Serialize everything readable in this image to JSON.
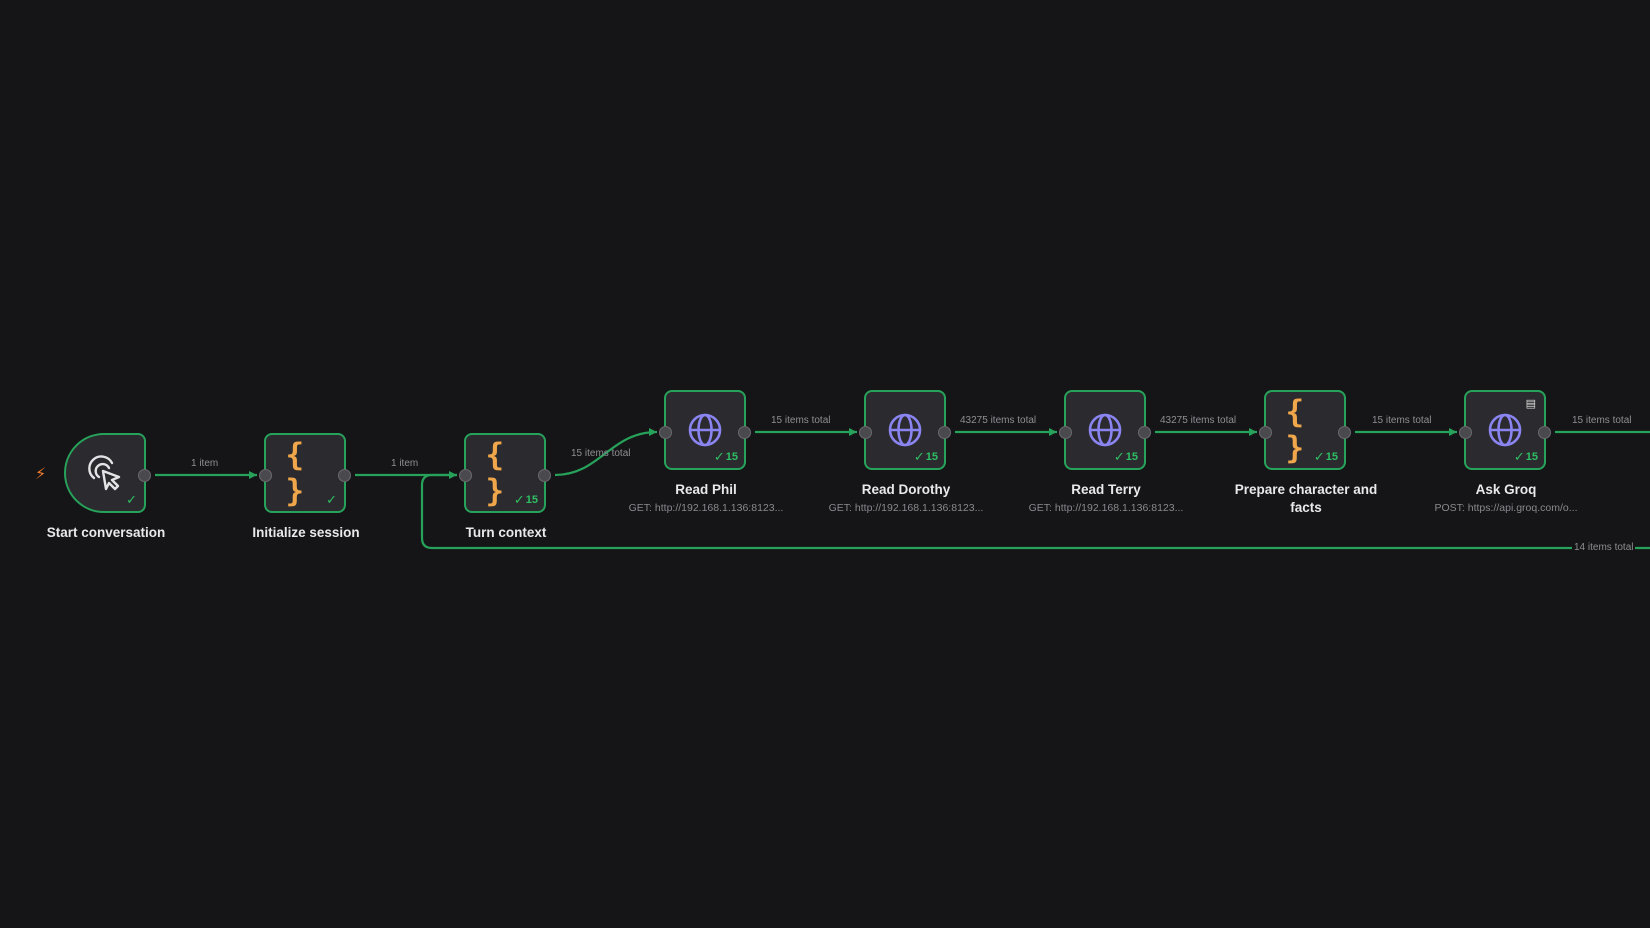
{
  "nodes": [
    {
      "id": "start",
      "label": "Start conversation",
      "icon": "cursor-click-icon",
      "badge": ""
    },
    {
      "id": "init",
      "label": "Initialize session",
      "icon": "code-braces-icon",
      "badge": ""
    },
    {
      "id": "turn",
      "label": "Turn context",
      "icon": "code-braces-icon",
      "badge": "15"
    },
    {
      "id": "phil",
      "label": "Read Phil",
      "subtitle": "GET: http://192.168.1.136:8123...",
      "icon": "globe-icon",
      "badge": "15"
    },
    {
      "id": "dorothy",
      "label": "Read Dorothy",
      "subtitle": "GET: http://192.168.1.136:8123...",
      "icon": "globe-icon",
      "badge": "15"
    },
    {
      "id": "terry",
      "label": "Read Terry",
      "subtitle": "GET: http://192.168.1.136:8123...",
      "icon": "globe-icon",
      "badge": "15"
    },
    {
      "id": "prepare",
      "label": "Prepare character and facts",
      "icon": "code-braces-icon",
      "badge": "15"
    },
    {
      "id": "groq",
      "label": "Ask Groq",
      "subtitle": "POST: https://api.groq.com/o...",
      "icon": "globe-icon",
      "badge": "15"
    }
  ],
  "edges": {
    "start_init": "1 item",
    "init_turn": "1 item",
    "turn_phil": "15 items total",
    "phil_dorothy": "15 items total",
    "dorothy_terry": "43275 items total",
    "terry_prepare": "43275 items total",
    "prepare_groq": "15 items total",
    "groq_out": "15 items total",
    "loop_back": "14 items total"
  },
  "colors": {
    "background": "#151417",
    "connection": "#27a25a",
    "node_fill": "#2b2a2e",
    "code_icon": "#f0a64a",
    "globe_icon": "#8a84f0",
    "trigger_bolt": "#f07a2a"
  }
}
